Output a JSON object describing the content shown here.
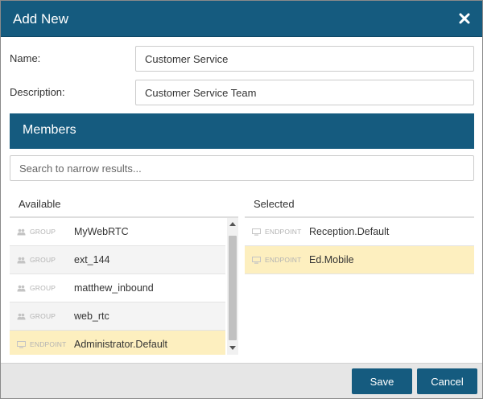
{
  "dialog": {
    "title": "Add New",
    "close_icon": "close-icon"
  },
  "form": {
    "name_label": "Name:",
    "name_value": "Customer Service",
    "description_label": "Description:",
    "description_value": "Customer Service Team"
  },
  "members": {
    "heading": "Members",
    "search_placeholder": "Search to narrow results...",
    "available_heading": "Available",
    "selected_heading": "Selected",
    "available": [
      {
        "type": "GROUP",
        "icon": "users-icon",
        "name": "MyWebRTC"
      },
      {
        "type": "GROUP",
        "icon": "users-icon",
        "name": "ext_144"
      },
      {
        "type": "GROUP",
        "icon": "users-icon",
        "name": "matthew_inbound"
      },
      {
        "type": "GROUP",
        "icon": "users-icon",
        "name": "web_rtc"
      },
      {
        "type": "ENDPOINT",
        "icon": "monitor-icon",
        "name": "Administrator.Default"
      }
    ],
    "selected": [
      {
        "type": "ENDPOINT",
        "icon": "monitor-icon",
        "name": "Reception.Default"
      },
      {
        "type": "ENDPOINT",
        "icon": "monitor-icon",
        "name": "Ed.Mobile"
      }
    ]
  },
  "footer": {
    "save_label": "Save",
    "cancel_label": "Cancel"
  },
  "colors": {
    "header_blue": "#155b7f",
    "highlight": "#fdefbf",
    "footer_bg": "#e6e6e6"
  }
}
